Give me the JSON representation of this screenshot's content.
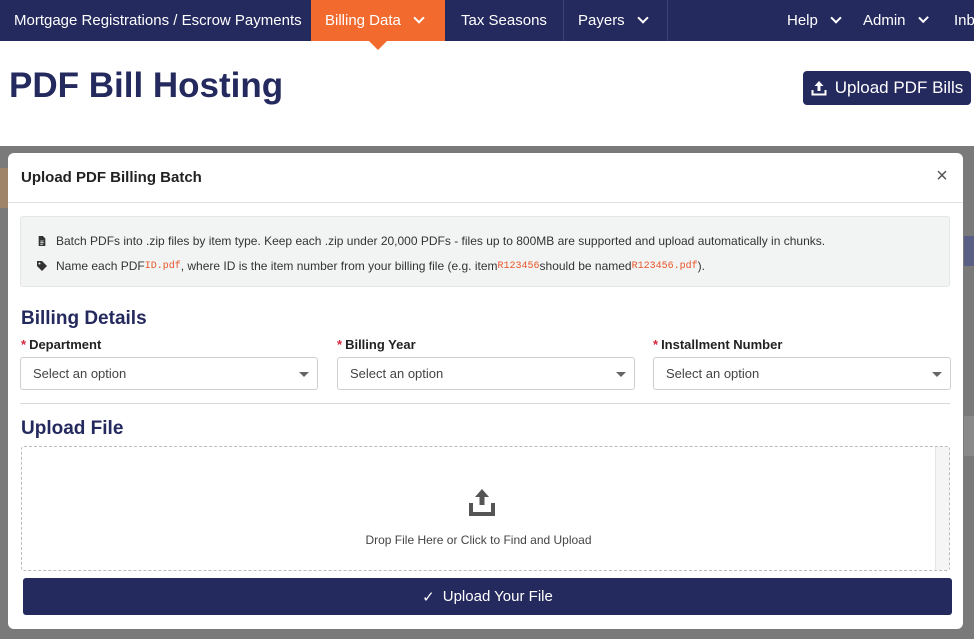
{
  "nav": {
    "items": [
      {
        "label": "Mortgage Registrations / Escrow Payments"
      },
      {
        "label": "Billing Data"
      },
      {
        "label": "Tax Seasons"
      },
      {
        "label": "Payers"
      },
      {
        "label": "Help"
      },
      {
        "label": "Admin"
      },
      {
        "label": "Inb"
      }
    ]
  },
  "page": {
    "title": "PDF Bill Hosting",
    "upload_button": "Upload PDF Bills"
  },
  "modal": {
    "title": "Upload PDF Billing Batch",
    "close": "×",
    "info": {
      "line1": "Batch PDFs into .zip files by item type. Keep each .zip under 20,000 PDFs - files up to 800MB are supported and upload automatically in chunks.",
      "line2_a": "Name each PDF ",
      "line2_code1": "ID.pdf",
      "line2_b": ", where ID is the item number from your billing file (e.g. item ",
      "line2_code2": "R123456",
      "line2_c": " should be named ",
      "line2_code3": "R123456.pdf",
      "line2_d": ")."
    },
    "billing_details": {
      "title": "Billing Details",
      "fields": [
        {
          "label": "Department",
          "value": "Select an option"
        },
        {
          "label": "Billing Year",
          "value": "Select an option"
        },
        {
          "label": "Installment Number",
          "value": "Select an option"
        }
      ],
      "required_mark": "*"
    },
    "upload": {
      "title": "Upload File",
      "drop_text": "Drop File Here or Click to Find and Upload",
      "submit": "Upload Your File",
      "submit_check": "✓"
    }
  },
  "colors": {
    "navy": "#24295e",
    "accent": "#f26a2e",
    "code": "#e8552a",
    "required": "#d9263b"
  }
}
